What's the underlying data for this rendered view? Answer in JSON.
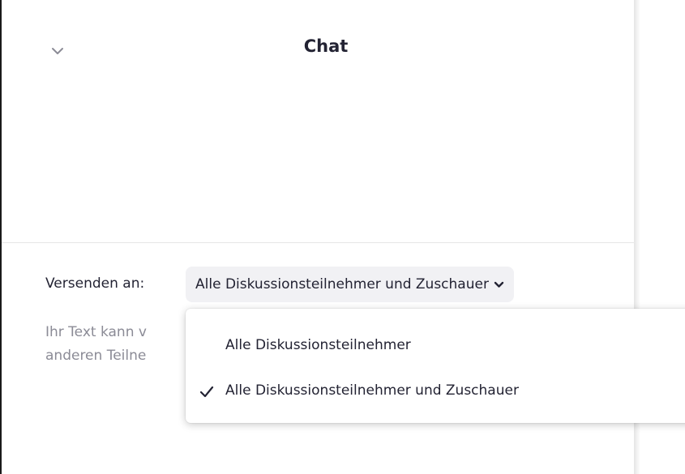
{
  "chat_panel": {
    "title": "Chat",
    "collapse_icon": "chevron-down-icon"
  },
  "composer": {
    "send_to_label": "Versenden an:",
    "recipient_value": "Alle Diskussionsteilnehmer und Zuschauer",
    "recipient_icon": "chevron-down-icon",
    "placeholder_line1": "Ihr Text kann v",
    "placeholder_line2": "anderen Teilne"
  },
  "recipient_menu": {
    "items": [
      {
        "label": "Alle Diskussionsteilnehmer",
        "selected": false
      },
      {
        "label": "Alle Diskussionsteilnehmer und Zuschauer",
        "selected": true
      }
    ],
    "check_icon": "checkmark-icon"
  },
  "colors": {
    "text": "#232333",
    "muted_text": "#8b8b96",
    "dropdown_bg": "#f1f1f4",
    "divider": "#e6e6e6"
  }
}
